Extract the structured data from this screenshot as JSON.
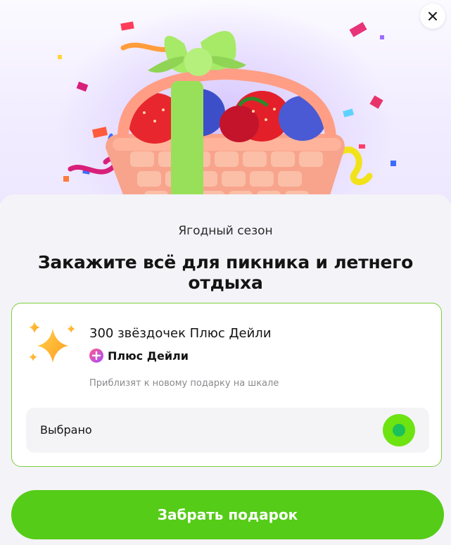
{
  "hero": {
    "image_name": "berry-basket-gift-illustration",
    "close_icon": "close-icon"
  },
  "promo": {
    "eyebrow": "Ягодный сезон",
    "title": "Закажите всё для пикника и летнего отдыха"
  },
  "reward": {
    "icon": "sparkle-stars-icon",
    "title": "300 звёздочек Плюс Дейли",
    "badge_icon": "plus-daily-icon",
    "badge_label": "Плюс Дейли",
    "subtitle": "Приблизят к новому подарку на шкале",
    "selected_label": "Выбрано",
    "selected": true
  },
  "cta": {
    "label": "Забрать подарок"
  },
  "colors": {
    "accent_green": "#55cc17",
    "radio_green": "#6ee312",
    "card_border": "#7fcf3c",
    "panel_bg": "#f3f3f8"
  }
}
